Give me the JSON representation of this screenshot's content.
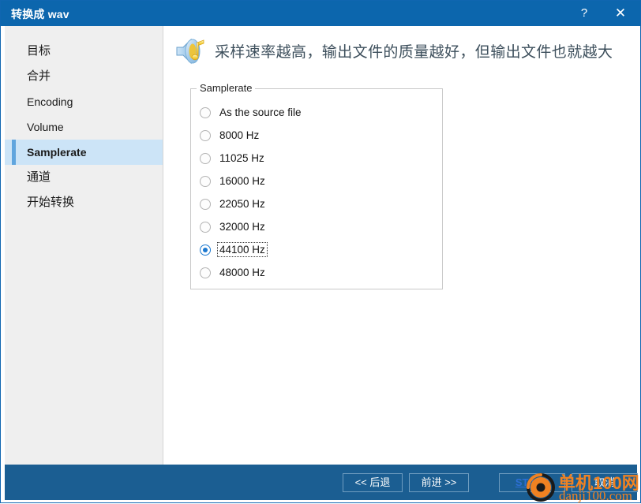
{
  "window": {
    "title": "转换成 wav",
    "help_label": "?",
    "close_label": "✕"
  },
  "sidebar": {
    "items": [
      {
        "label": "目标",
        "selected": false
      },
      {
        "label": "合并",
        "selected": false
      },
      {
        "label": "Encoding",
        "selected": false
      },
      {
        "label": "Volume",
        "selected": false
      },
      {
        "label": "Samplerate",
        "selected": true
      },
      {
        "label": "通道",
        "selected": false
      },
      {
        "label": "开始转换",
        "selected": false
      }
    ]
  },
  "header": {
    "icon": "speaker-music-note-icon",
    "text": "采样速率越高，输出文件的质量越好，但输出文件也就越大"
  },
  "group": {
    "legend": "Samplerate",
    "options": [
      {
        "label": "As the source file",
        "checked": false
      },
      {
        "label": "8000 Hz",
        "checked": false
      },
      {
        "label": "11025 Hz",
        "checked": false
      },
      {
        "label": "16000 Hz",
        "checked": false
      },
      {
        "label": "22050 Hz",
        "checked": false
      },
      {
        "label": "32000 Hz",
        "checked": false
      },
      {
        "label": "44100 Hz",
        "checked": true
      },
      {
        "label": "48000 Hz",
        "checked": false
      }
    ],
    "selected_value": "44100 Hz"
  },
  "footer": {
    "back_label": "<< 后退",
    "next_label": "前进 >>",
    "start_label": "START",
    "cancel_label": "取消"
  },
  "watermark": {
    "line1": "单机100网",
    "line2": "danji100.com"
  },
  "colors": {
    "titlebar": "#0c66ad",
    "footer": "#1b5e92",
    "sidebar": "#efefef",
    "selection": "#cce4f7",
    "accent_bar": "#60a5de",
    "radio_checked": "#1c79d0",
    "start_text": "#2d6fd4",
    "watermark": "#f08222"
  }
}
